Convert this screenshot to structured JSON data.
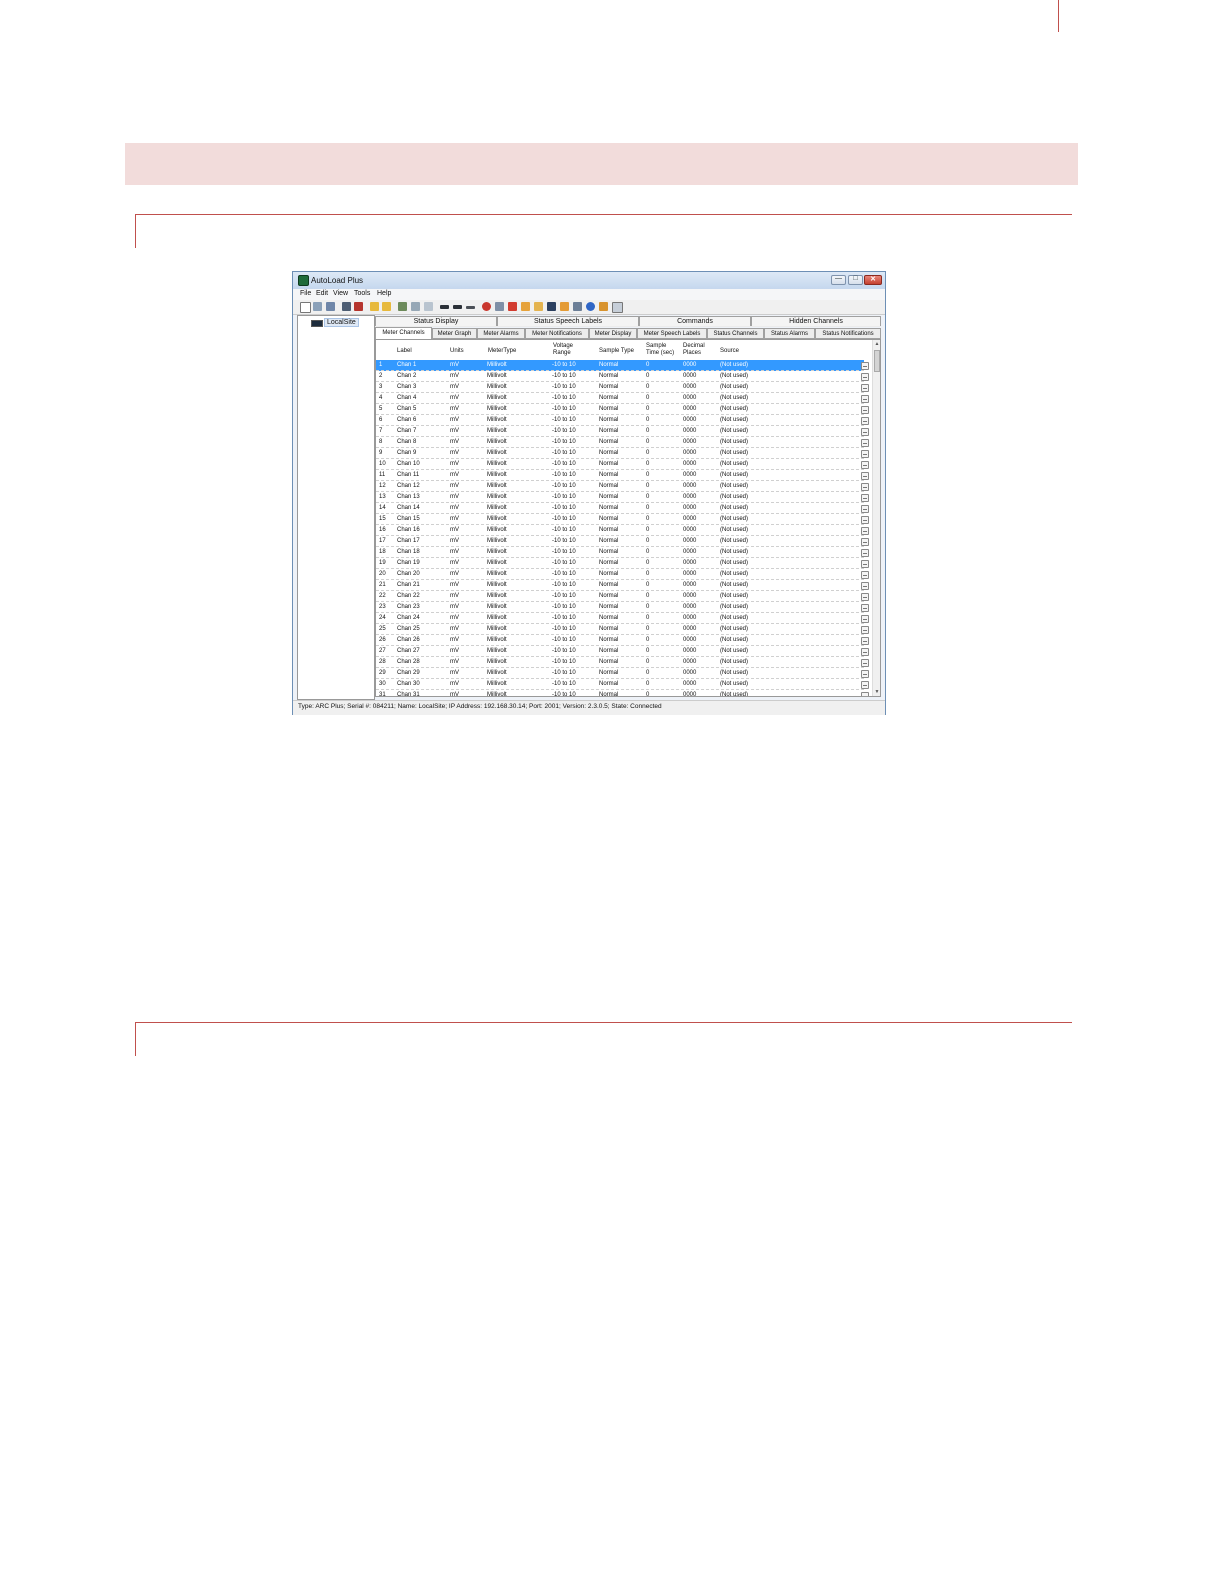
{
  "window": {
    "title": "AutoLoad Plus",
    "min_glyph": "—",
    "max_glyph": "□",
    "close_glyph": "✕"
  },
  "menu": [
    "File",
    "Edit",
    "View",
    "Tools",
    "Help"
  ],
  "tree": {
    "site_label": "LocalSite"
  },
  "tabs_top": [
    "Status Display",
    "Status Speech Labels",
    "Commands",
    "Hidden Channels"
  ],
  "tabs_sub": [
    "Meter Channels",
    "Meter Graph",
    "Meter Alarms",
    "Meter Notifications",
    "Meter Display",
    "Meter Speech Labels",
    "Status Channels",
    "Status Alarms",
    "Status Notifications"
  ],
  "active_sub_tab": "Meter Channels",
  "table": {
    "headers": {
      "label": "Label",
      "units": "Units",
      "meter_type": "MeterType",
      "voltage_range_1": "Voltage",
      "voltage_range_2": "Range",
      "sample_type": "Sample Type",
      "sample_time_1": "Sample",
      "sample_time_2": "Time (sec)",
      "decimal_1": "Decimal",
      "decimal_2": "Places",
      "source": "Source"
    },
    "row_defaults": {
      "units": "mV",
      "meter_type": "Millivolt",
      "voltage_range": "-10 to 10",
      "sample_type": "Normal",
      "sample_time": "0",
      "decimal_places": "0000",
      "source": "(Not used)"
    },
    "rows": [
      {
        "num": "1",
        "label": "Chan 1"
      },
      {
        "num": "2",
        "label": "Chan 2"
      },
      {
        "num": "3",
        "label": "Chan 3"
      },
      {
        "num": "4",
        "label": "Chan 4"
      },
      {
        "num": "5",
        "label": "Chan 5"
      },
      {
        "num": "6",
        "label": "Chan 6"
      },
      {
        "num": "7",
        "label": "Chan 7"
      },
      {
        "num": "8",
        "label": "Chan 8"
      },
      {
        "num": "9",
        "label": "Chan 9"
      },
      {
        "num": "10",
        "label": "Chan 10"
      },
      {
        "num": "11",
        "label": "Chan 11"
      },
      {
        "num": "12",
        "label": "Chan 12"
      },
      {
        "num": "13",
        "label": "Chan 13"
      },
      {
        "num": "14",
        "label": "Chan 14"
      },
      {
        "num": "15",
        "label": "Chan 15"
      },
      {
        "num": "16",
        "label": "Chan 16"
      },
      {
        "num": "17",
        "label": "Chan 17"
      },
      {
        "num": "18",
        "label": "Chan 18"
      },
      {
        "num": "19",
        "label": "Chan 19"
      },
      {
        "num": "20",
        "label": "Chan 20"
      },
      {
        "num": "21",
        "label": "Chan 21"
      },
      {
        "num": "22",
        "label": "Chan 22"
      },
      {
        "num": "23",
        "label": "Chan 23"
      },
      {
        "num": "24",
        "label": "Chan 24"
      },
      {
        "num": "25",
        "label": "Chan 25"
      },
      {
        "num": "26",
        "label": "Chan 26"
      },
      {
        "num": "27",
        "label": "Chan 27"
      },
      {
        "num": "28",
        "label": "Chan 28"
      },
      {
        "num": "29",
        "label": "Chan 29"
      },
      {
        "num": "30",
        "label": "Chan 30"
      },
      {
        "num": "31",
        "label": "Chan 31"
      }
    ],
    "selected_row": "1"
  },
  "statusbar": {
    "text": "Type: ARC Plus; Serial #: 084211; Name: LocalSite; IP Address: 192.168.30.14; Port: 2001; Version: 2.3.0.5; State: Connected"
  },
  "colors": {
    "banner": "#f2dcdb",
    "rule": "#c0504d",
    "selection": "#3399ff"
  }
}
